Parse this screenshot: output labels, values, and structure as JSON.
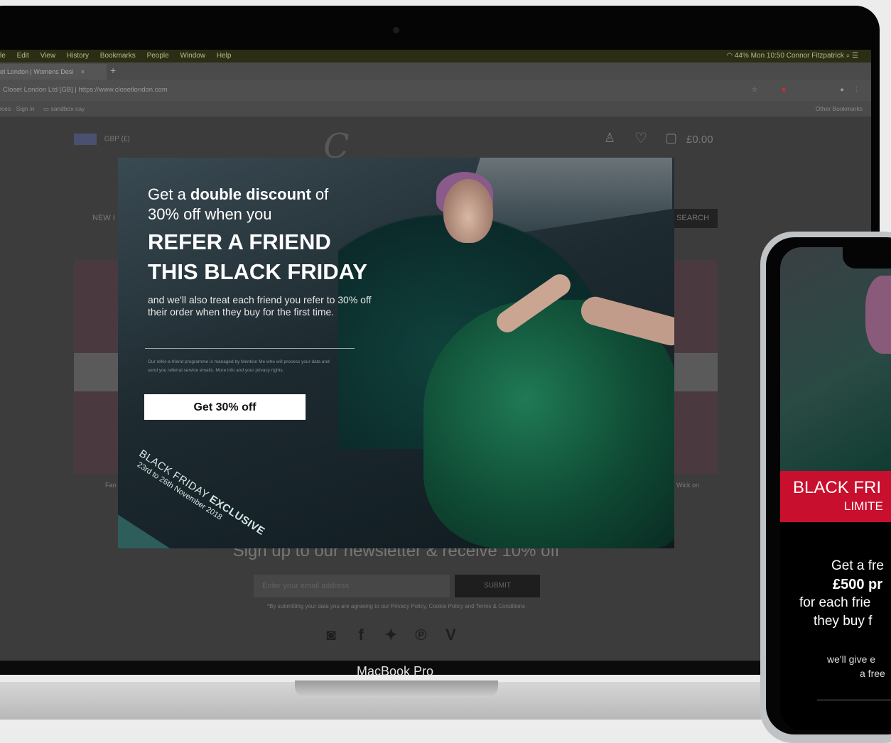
{
  "menubar": {
    "items": [
      "le",
      "Edit",
      "View",
      "History",
      "Bookmarks",
      "People",
      "Window",
      "Help"
    ],
    "battery": "44%",
    "clock": "Mon 10:50",
    "user": "Connor Fitzpatrick"
  },
  "browser": {
    "tab_title": "et London | Womens Desi",
    "tab_close": "×",
    "new_tab": "+",
    "address_security": "Closet London Ltd [GB]",
    "address_url": "https://www.closetlondon.com",
    "bookmark_1": "ices · Sign in",
    "bookmark_2": "sandbox cay",
    "bookmark_other": "Other Bookmarks"
  },
  "site": {
    "currency": "GBP (£)",
    "cart_total": "£0.00",
    "nav_first": "NEW I",
    "search_label": "SEARCH",
    "caption_left": "Fan",
    "caption_right": "Wick on",
    "newsletter": {
      "heading": "Sign up to our newsletter & receive 10% off",
      "placeholder": "Enter your email address",
      "submit": "SUBMIT",
      "terms": "*By submitting your data you are agreeing to our Privacy Policy, Cookie Policy and Terms & Conditions"
    }
  },
  "popup": {
    "line1_pre": "Get a ",
    "line1_bold": "double discount",
    "line1_post": " of",
    "line2": "30% off when you",
    "refer1": "REFER A FRIEND",
    "refer2": "THIS BLACK FRIDAY",
    "body": "and we'll also treat each friend you refer to 30% off their order when they buy for the first time.",
    "small": "Our refer-a-friend programme is managed by Mention Me who will process your data and send you referral service emails. More info and your privacy rights.",
    "cta": "Get 30% off",
    "exclusive_pre": "BLACK FRIDAY ",
    "exclusive_bold": "EXCLUSIVE",
    "dates": "23rd to 26th November 2018"
  },
  "laptop": {
    "brand": "MacBook Pro"
  },
  "phone": {
    "band1": "BLACK FRI",
    "band2": "LIMITE",
    "t1": "Get a fre",
    "t2": "£500 pr",
    "t3": "for each frie",
    "t4": "they buy f",
    "t5": "we'll give e",
    "t6": "a free"
  },
  "colors": {
    "accent_red": "#c8102e",
    "popup_teal": "#2e5e5b"
  }
}
